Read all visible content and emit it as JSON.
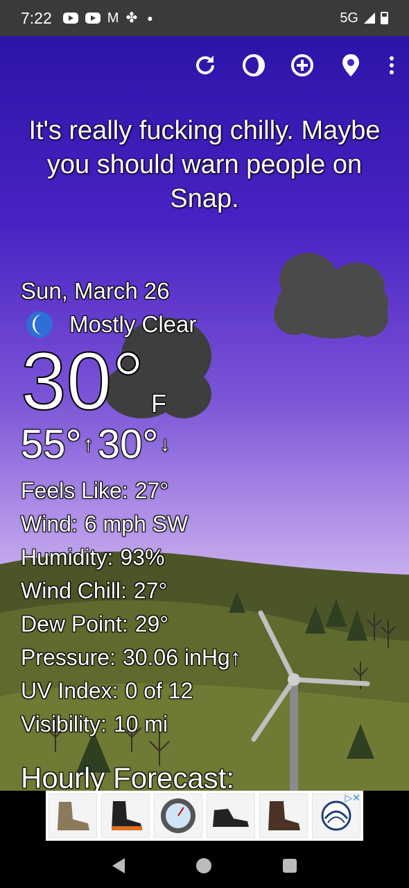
{
  "status_bar": {
    "time": "7:22",
    "network": "5G"
  },
  "toolbar": {
    "refresh": "refresh-icon",
    "theme": "moon-phase-icon",
    "add": "add-location-icon",
    "location": "location-pin-icon",
    "menu": "more-vert-icon"
  },
  "headline": "It's really fucking chilly. Maybe you should warn people on Snap.",
  "current": {
    "date": "Sun, March 26",
    "condition": "Mostly Clear",
    "temperature": "30°",
    "unit": "F",
    "high": "55°",
    "low": "30°"
  },
  "details": [
    {
      "label": "Feels Like:",
      "value": "27°"
    },
    {
      "label": "Wind:",
      "value": "6 mph SW"
    },
    {
      "label": "Humidity:",
      "value": "93%"
    },
    {
      "label": "Wind Chill:",
      "value": "27°"
    },
    {
      "label": "Dew Point:",
      "value": "29°"
    },
    {
      "label": "Pressure:",
      "value": "30.06 inHg↑"
    },
    {
      "label": "UV Index:",
      "value": "0 of 12"
    },
    {
      "label": "Visibility:",
      "value": "10 mi"
    }
  ],
  "hourly_heading": "Hourly Forecast:",
  "colors": {
    "sky_top": "#2c14a8",
    "sky_bottom": "#c9b0ef",
    "cloud": "#4a4a4a",
    "hills": "#505a2c"
  }
}
